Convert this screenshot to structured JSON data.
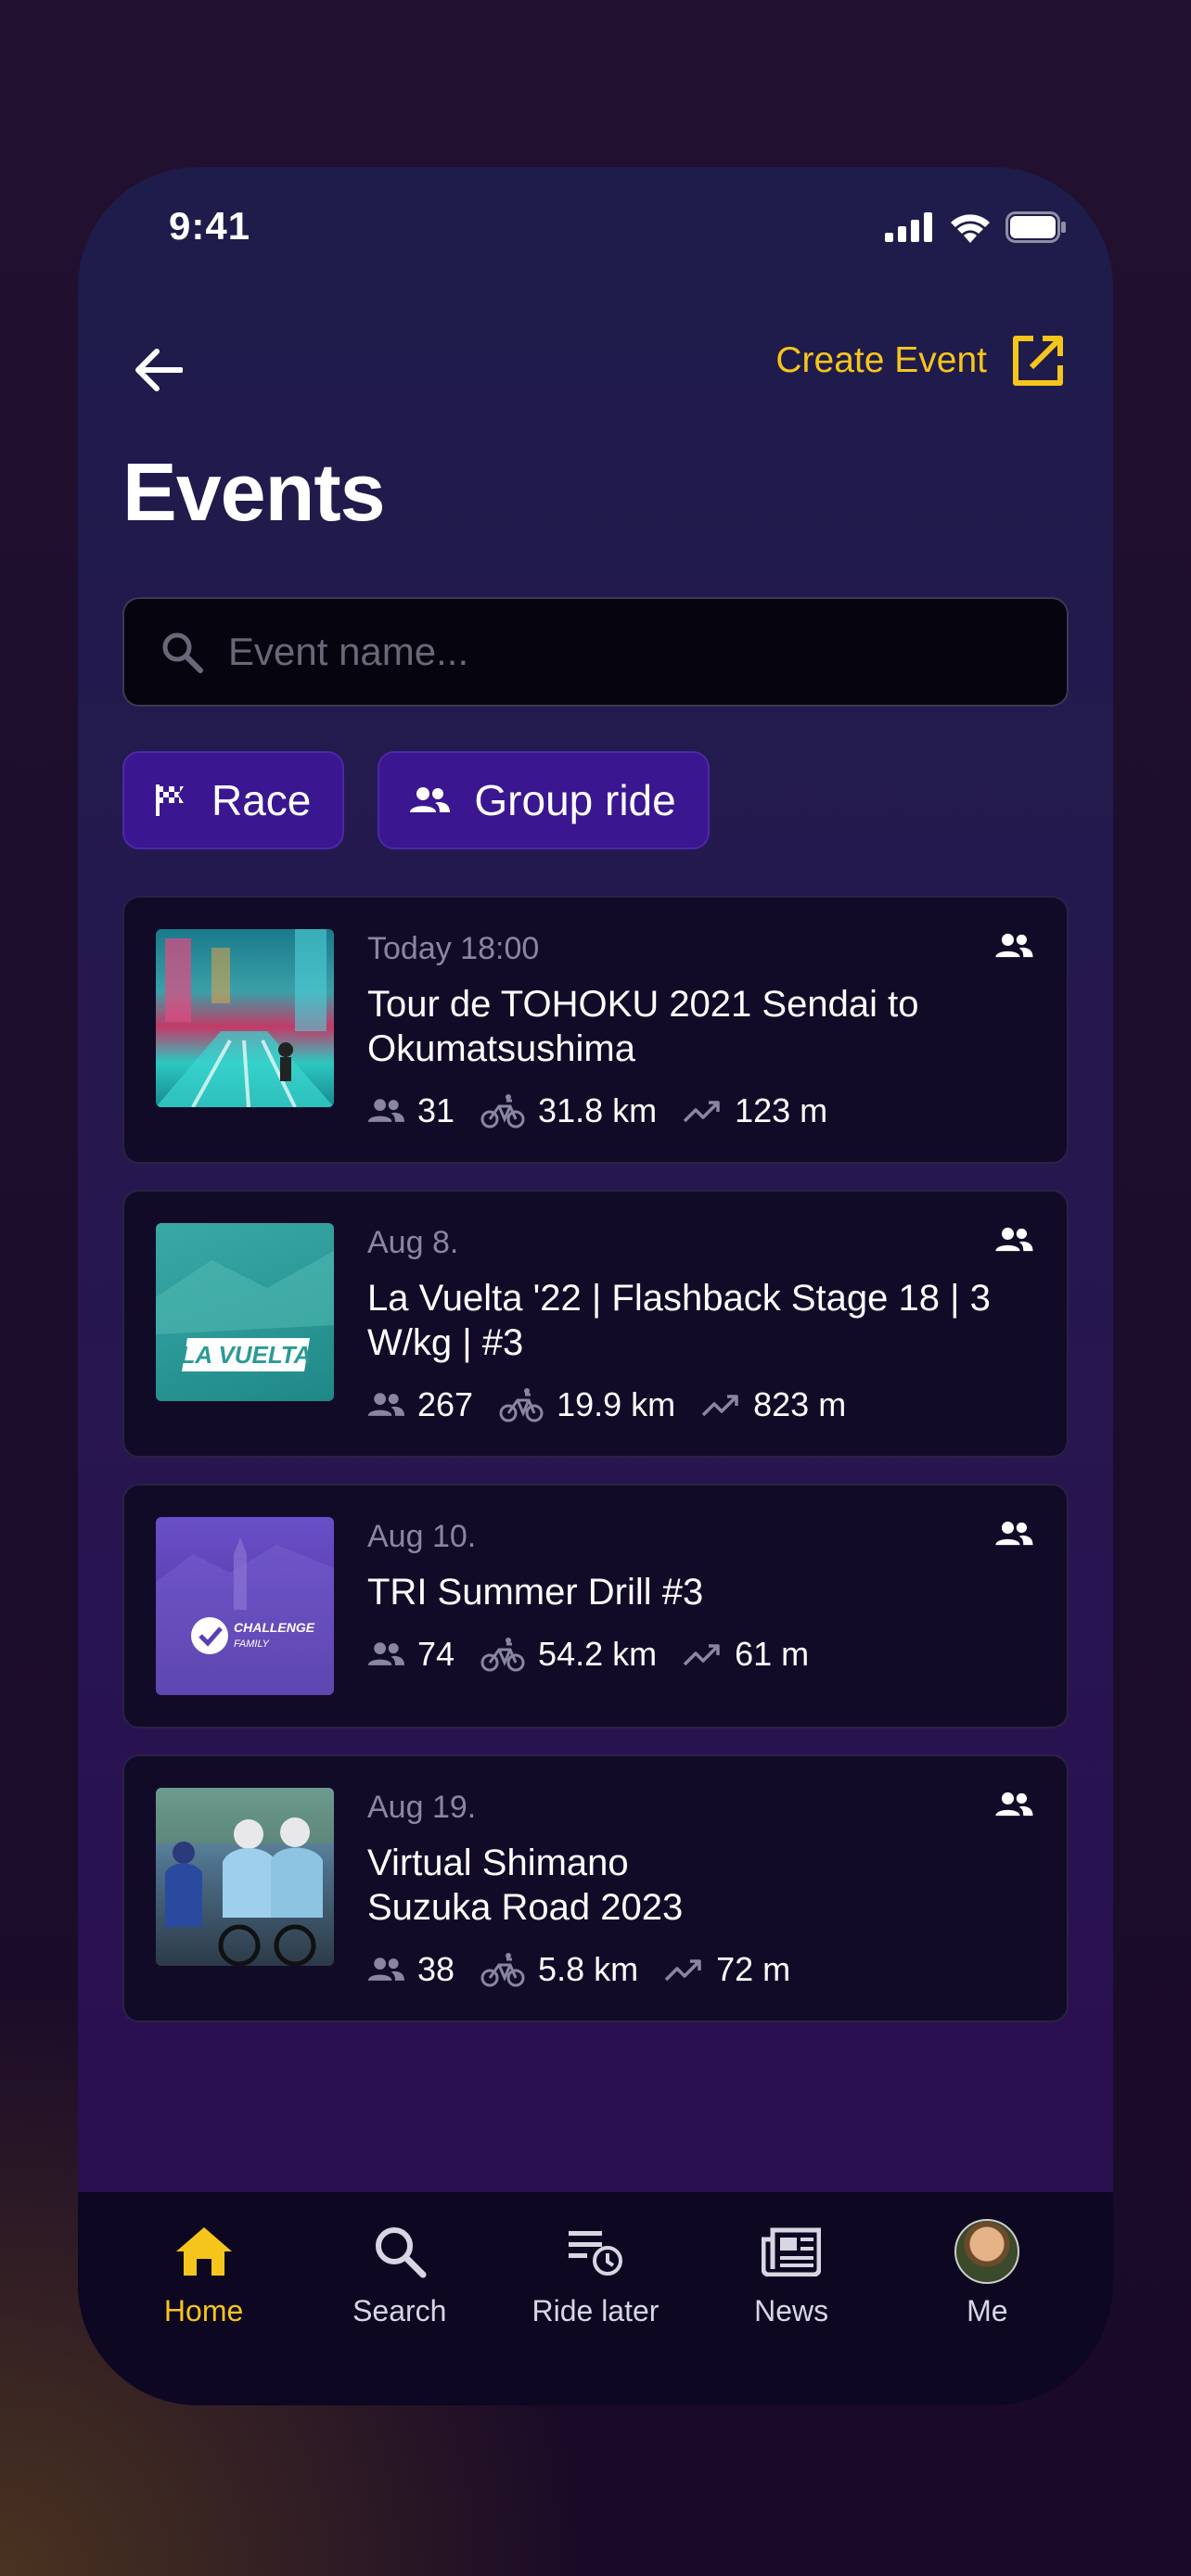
{
  "status": {
    "time": "9:41"
  },
  "header": {
    "create_event_label": "Create Event",
    "title": "Events"
  },
  "search": {
    "placeholder": "Event name..."
  },
  "filters": [
    {
      "label": "Race",
      "icon": "checkered-flag-icon"
    },
    {
      "label": "Group ride",
      "icon": "group-icon"
    }
  ],
  "events": [
    {
      "date": "Today 18:00",
      "name": "Tour de TOHOKU 2021 Sendai to Okumatsushima",
      "riders": "31",
      "distance": "31.8 km",
      "elevation": "123 m",
      "thumb": "city-night"
    },
    {
      "date": "Aug 8.",
      "name": "La Vuelta '22 | Flashback Stage 18 | 3 W/kg | #3",
      "riders": "267",
      "distance": "19.9 km",
      "elevation": "823 m",
      "thumb": "la-vuelta",
      "thumb_text": "LA VUELTA"
    },
    {
      "date": "Aug 10.",
      "name": "TRI Summer Drill #3",
      "riders": "74",
      "distance": "54.2 km",
      "elevation": "61 m",
      "thumb": "challenge-family",
      "thumb_text": "CHALLENGE",
      "thumb_text2": "FAMILY"
    },
    {
      "date": "Aug 19.",
      "name": "Virtual Shimano Suzuka Road 2023",
      "riders": "38",
      "distance": "5.8 km",
      "elevation": "72 m",
      "thumb": "cyclists"
    }
  ],
  "nav": {
    "home": "Home",
    "search": "Search",
    "ride_later": "Ride later",
    "news": "News",
    "me": "Me"
  },
  "colors": {
    "accent": "#f6c51b",
    "chip": "#3a1790",
    "card": "#120b28"
  }
}
